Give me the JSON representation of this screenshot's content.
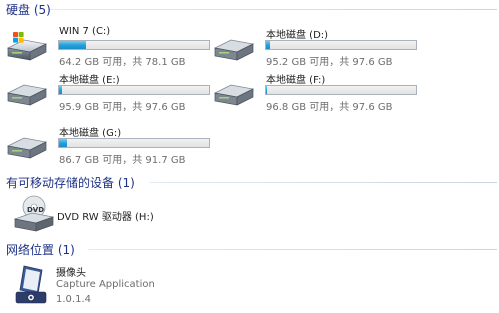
{
  "groups": {
    "hard_disks": "硬盘 (5)",
    "removable": "有可移动存储的设备 (1)",
    "network": "网络位置 (1)"
  },
  "colors": {
    "group_title": "#1e3287",
    "bar_fill": "#26a0da",
    "secondary_text": "#6d6d6d"
  },
  "drives": [
    {
      "name": "WIN 7 (C:)",
      "free_text": "64.2 GB 可用，共 78.1 GB",
      "used_fraction": 0.18,
      "icon": "windows-system-drive-icon"
    },
    {
      "name": "本地磁盘 (D:)",
      "free_text": "95.2 GB 可用，共 97.6 GB",
      "used_fraction": 0.025,
      "icon": "hard-drive-icon"
    },
    {
      "name": "本地磁盘 (E:)",
      "free_text": "95.9 GB 可用，共 97.6 GB",
      "used_fraction": 0.017,
      "icon": "hard-drive-icon"
    },
    {
      "name": "本地磁盘 (F:)",
      "free_text": "96.8 GB 可用，共 97.6 GB",
      "used_fraction": 0.008,
      "icon": "hard-drive-icon"
    },
    {
      "name": "本地磁盘 (G:)",
      "free_text": "86.7 GB 可用，共 91.7 GB",
      "used_fraction": 0.055,
      "icon": "hard-drive-icon"
    }
  ],
  "dvd": {
    "name": "DVD RW 驱动器 (H:)",
    "icon": "dvd-drive-icon",
    "disc_label": "DVD"
  },
  "network_items": [
    {
      "name": "摄像头",
      "type": "Capture Application",
      "version": "1.0.1.4",
      "icon": "webcam-capture-icon"
    }
  ]
}
